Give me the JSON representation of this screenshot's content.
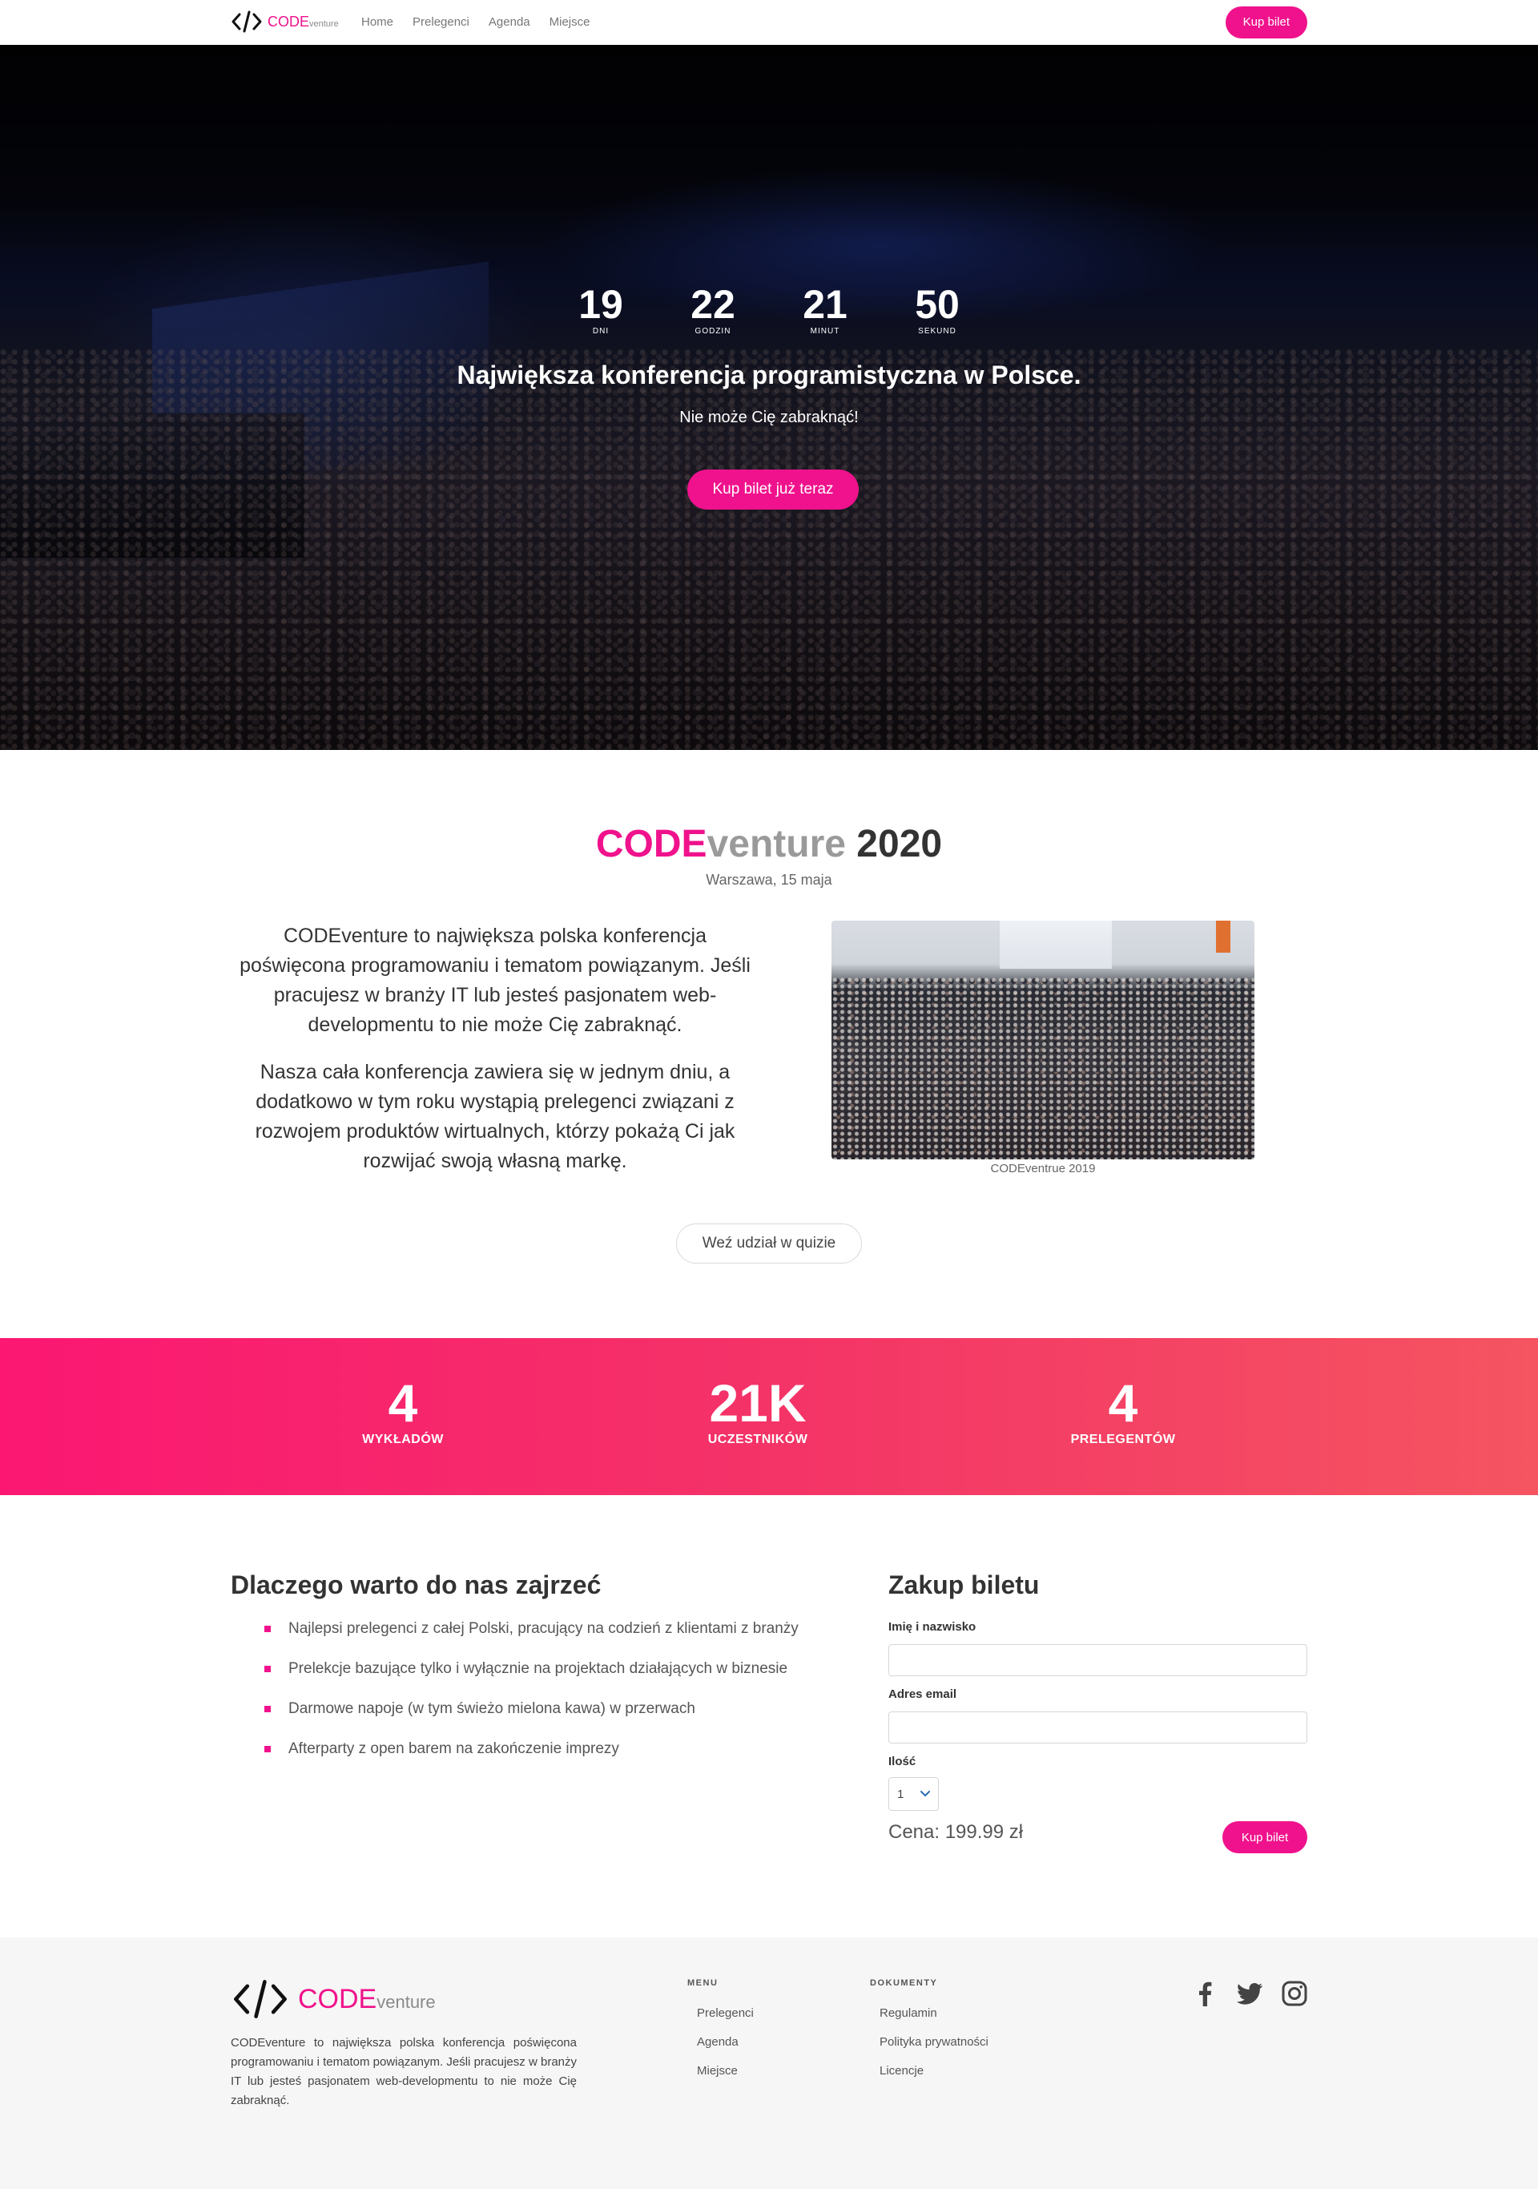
{
  "nav": {
    "logo_code": "CODE",
    "logo_venture": "venture",
    "links": [
      "Home",
      "Prelegenci",
      "Agenda",
      "Miejsce"
    ],
    "cta": "Kup bilet"
  },
  "hero": {
    "countdown": [
      {
        "value": "19",
        "label": "DNI"
      },
      {
        "value": "22",
        "label": "GODZIN"
      },
      {
        "value": "21",
        "label": "MINUT"
      },
      {
        "value": "50",
        "label": "SEKUND"
      }
    ],
    "title": "Największa konferencja programistyczna w Polsce.",
    "subtitle": "Nie może Cię zabraknąć!",
    "cta": "Kup bilet już teraz"
  },
  "about": {
    "title_code": "CODE",
    "title_venture": "venture",
    "title_year": " 2020",
    "date": "Warszawa, 15 maja",
    "paragraphs": [
      "CODEventure to największa polska konferencja poświęcona programowaniu i tematom powiązanym. Jeśli pracujesz w branży IT lub jesteś pasjonatem web-developmentu to nie może Cię zabraknąć.",
      "Nasza cała konferencja zawiera się w jednym dniu, a dodatkowo w tym roku wystąpią prelegenci związani z rozwojem produktów wirtualnych, którzy pokażą Ci jak rozwijać swoją własną markę."
    ],
    "photo_caption": "CODEventrue 2019",
    "quiz_button": "Weź udział w quizie"
  },
  "stats": [
    {
      "value": "4",
      "label": "WYKŁADÓW"
    },
    {
      "value": "21K",
      "label": "UCZESTNIKÓW"
    },
    {
      "value": "4",
      "label": "PRELEGENTÓW"
    }
  ],
  "why": {
    "title": "Dlaczego warto do nas zajrzeć",
    "items": [
      "Najlepsi prelegenci z całej Polski, pracujący na codzień z klientami z branży",
      "Prelekcje bazujące tylko i wyłącznie na projektach działających w biznesie",
      "Darmowe napoje (w tym świeżo mielona kawa) w przerwach",
      "Afterparty z open barem na zakończenie imprezy"
    ]
  },
  "purchase": {
    "title": "Zakup biletu",
    "name_label": "Imię i nazwisko",
    "name_value": "",
    "email_label": "Adres email",
    "email_value": "",
    "qty_label": "Ilość",
    "qty_value": "1",
    "price": "Cena: 199.99 zł",
    "button": "Kup bilet"
  },
  "footer": {
    "logo_code": "CODE",
    "logo_venture": "venture",
    "description": "CODEventure to największa polska konferencja poświęcona programowaniu i tematom powiązanym. Jeśli pracujesz w branży IT lub jesteś pasjonatem web-developmentu to nie może Cię zabraknąć.",
    "menu_heading": "MENU",
    "menu_links": [
      "Prelegenci",
      "Agenda",
      "Miejsce"
    ],
    "docs_heading": "DOKUMENTY",
    "docs_links": [
      "Regulamin",
      "Polityka prywatności",
      "Licencje"
    ],
    "social": [
      "facebook-icon",
      "twitter-icon",
      "instagram-icon"
    ]
  },
  "colors": {
    "accent": "#f0128c",
    "stats_gradient_start": "#fb1772",
    "stats_gradient_end": "#f55461",
    "footer_bg": "#f6f6f6"
  }
}
